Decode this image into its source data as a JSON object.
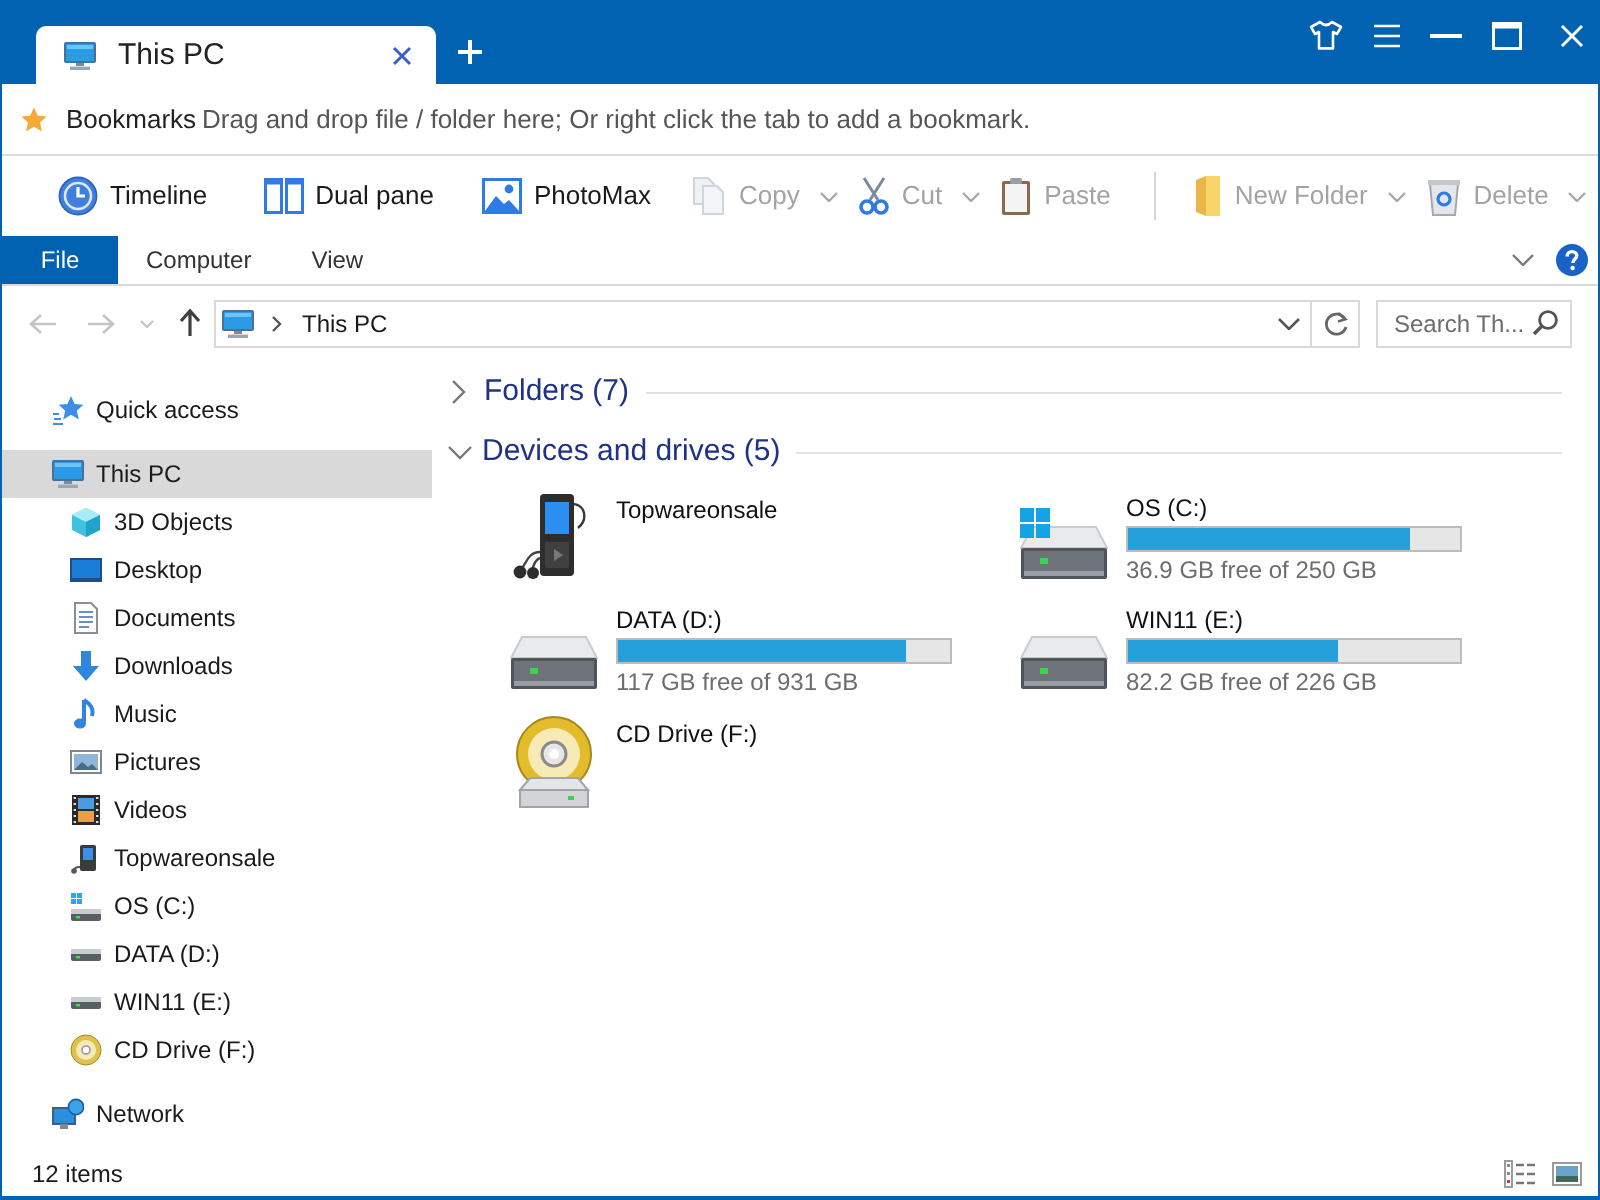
{
  "title_bar": {
    "tabs": [
      {
        "label": "This PC",
        "selected": true
      }
    ]
  },
  "bookmarks_bar": {
    "label": "Bookmarks",
    "hint": "Drag and drop file / folder here; Or right click the tab to add a bookmark."
  },
  "toolbar": {
    "groups": [
      [
        {
          "kind": "timeline",
          "label": "Timeline",
          "disabled": false,
          "dropdown": false
        },
        {
          "kind": "dualpane",
          "label": "Dual pane",
          "disabled": false,
          "dropdown": false
        },
        {
          "kind": "photomax",
          "label": "PhotoMax",
          "disabled": false,
          "dropdown": false
        },
        {
          "kind": "copy",
          "label": "Copy",
          "disabled": true,
          "dropdown": true
        },
        {
          "kind": "cut",
          "label": "Cut",
          "disabled": true,
          "dropdown": true
        },
        {
          "kind": "paste",
          "label": "Paste",
          "disabled": true,
          "dropdown": false
        }
      ],
      [
        {
          "kind": "newfolder",
          "label": "New Folder",
          "disabled": true,
          "dropdown": true
        },
        {
          "kind": "delete",
          "label": "Delete",
          "disabled": true,
          "dropdown": true
        }
      ]
    ]
  },
  "ribbon_tabs": [
    {
      "label": "File",
      "selected": true
    },
    {
      "label": "Computer",
      "selected": false
    },
    {
      "label": "View",
      "selected": false
    }
  ],
  "navigation": [
    {
      "kind": "back",
      "disabled": true
    },
    {
      "kind": "forward",
      "disabled": true
    },
    {
      "kind": "recent",
      "disabled": true
    },
    {
      "kind": "up",
      "disabled": false
    }
  ],
  "address_bar": {
    "path": [
      "This PC"
    ]
  },
  "search": {
    "placeholder": "Search Th..."
  },
  "sidebar": {
    "items": [
      {
        "label": "Quick access",
        "kind": "pinned",
        "selected": false
      },
      {
        "label": "This PC",
        "kind": "computer",
        "selected": true,
        "children": [
          {
            "label": "3D Objects",
            "kind": "objects",
            "selected": false
          },
          {
            "label": "Desktop",
            "kind": "desktop",
            "selected": false
          },
          {
            "label": "Documents",
            "kind": "documents",
            "selected": false
          },
          {
            "label": "Downloads",
            "kind": "downloads",
            "selected": false
          },
          {
            "label": "Music",
            "kind": "music",
            "selected": false
          },
          {
            "label": "Pictures",
            "kind": "pictures",
            "selected": false
          },
          {
            "label": "Videos",
            "kind": "videos",
            "selected": false
          },
          {
            "label": "Topwareonsale",
            "kind": "device",
            "selected": false
          },
          {
            "label": "OS (C:)",
            "kind": "system",
            "selected": false
          },
          {
            "label": "DATA (D:)",
            "kind": "drive",
            "selected": false
          },
          {
            "label": "WIN11 (E:)",
            "kind": "drive",
            "selected": false
          },
          {
            "label": "CD Drive (F:)",
            "kind": "optical",
            "selected": false
          }
        ]
      },
      {
        "label": "Network",
        "kind": "network",
        "selected": false
      }
    ]
  },
  "content": {
    "groups": [
      {
        "title": "Folders (7)",
        "expanded": false
      },
      {
        "title": "Devices and drives (5)",
        "expanded": true,
        "items": [
          {
            "kind": "player",
            "name": "Topwareonsale"
          },
          {
            "kind": "system",
            "name": "OS (C:)",
            "level": 0.85,
            "space": "36.9 GB free of 250 GB"
          },
          {
            "kind": "drive",
            "name": "DATA (D:)",
            "level": 0.87,
            "space": "117 GB free of 931 GB"
          },
          {
            "kind": "drive",
            "name": "WIN11 (E:)",
            "level": 0.63,
            "space": "82.2 GB free of 226 GB"
          },
          {
            "kind": "optical",
            "name": "CD Drive (F:)"
          }
        ]
      }
    ]
  },
  "status_bar": {
    "count": "12 items"
  }
}
